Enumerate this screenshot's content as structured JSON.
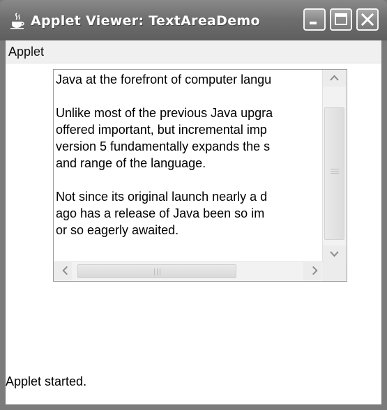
{
  "window": {
    "title": "Applet Viewer: TextAreaDemo"
  },
  "menu": {
    "items": [
      "Applet"
    ]
  },
  "textarea": {
    "lines": [
      "Java at the forefront of computer langu",
      "",
      "Unlike most of the previous Java upgra",
      "offered important, but incremental imp",
      "version 5 fundamentally expands the s",
      "and range of the language.",
      "",
      "Not since its original launch nearly a d",
      "ago has a release of Java been so im",
      "or so eagerly awaited."
    ]
  },
  "status": {
    "text": "Applet started."
  },
  "icons": {
    "app": "java-cup-icon",
    "minimize": "minimize-icon",
    "maximize": "maximize-icon",
    "close": "close-icon",
    "scroll_up": "arrow-up-icon",
    "scroll_down": "arrow-down-icon",
    "scroll_left": "arrow-left-icon",
    "scroll_right": "arrow-right-icon"
  },
  "colors": {
    "titlebar": "#6f6f6f",
    "client_background": "#ffffff",
    "menubar": "#f0f0f0"
  }
}
